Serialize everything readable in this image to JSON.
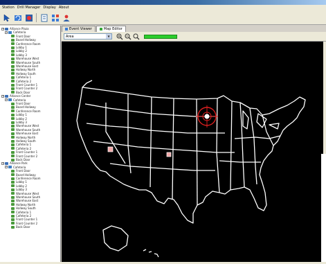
{
  "menu": {
    "items": [
      "Station",
      "Drill Manager",
      "Display",
      "About"
    ]
  },
  "toolbar": {
    "icons": [
      "pointer-icon",
      "refresh-icon",
      "alarm-icon",
      "list-icon",
      "grid-icon",
      "user-icon"
    ]
  },
  "tabs": [
    {
      "label": "Event Viewer"
    },
    {
      "label": "Map Editor"
    }
  ],
  "map_toolbar": {
    "layer_value": "Area",
    "status_level": 1.0
  },
  "colors": {
    "map_background": "#000000",
    "map_outline": "#ffffff",
    "alarm_marker": "#e02020",
    "device_marker": "#f2a8a8",
    "status_green": "#2ccd2c"
  },
  "tree": {
    "sections": [
      {
        "site": "Alliance Plaza",
        "group": "Cafeteria",
        "devices": [
          "Front Door",
          "Board Hallway",
          "Conference Room",
          "Lobby 1",
          "Lobby 2",
          "Lobby 3",
          "Warehouse West",
          "Warehouse South",
          "Warehouse East",
          "Hallway North",
          "Hallway South",
          "Cafeteria 1",
          "Cafeteria 2",
          "Front Counter 1",
          "Front Counter 2",
          "Back Door"
        ]
      },
      {
        "site": "Alliance Center",
        "group": "Cafeteria",
        "devices": [
          "Front Door",
          "Board Hallway",
          "Conference Room",
          "Lobby 1",
          "Lobby 2",
          "Lobby 3",
          "Warehouse West",
          "Warehouse South",
          "Warehouse East",
          "Hallway North",
          "Hallway South",
          "Cafeteria 1",
          "Cafeteria 2",
          "Front Counter 1",
          "Front Counter 2",
          "Back Door"
        ]
      },
      {
        "site": "Alliance Park",
        "group": "Cafeteria",
        "devices": [
          "Front Door",
          "Board Hallway",
          "Conference Room",
          "Lobby 1",
          "Lobby 2",
          "Lobby 3",
          "Warehouse West",
          "Warehouse South",
          "Warehouse East",
          "Hallway North",
          "Hallway South",
          "Cafeteria 1",
          "Cafeteria 2",
          "Front Counter 1",
          "Front Counter 2",
          "Back Door"
        ]
      }
    ]
  }
}
